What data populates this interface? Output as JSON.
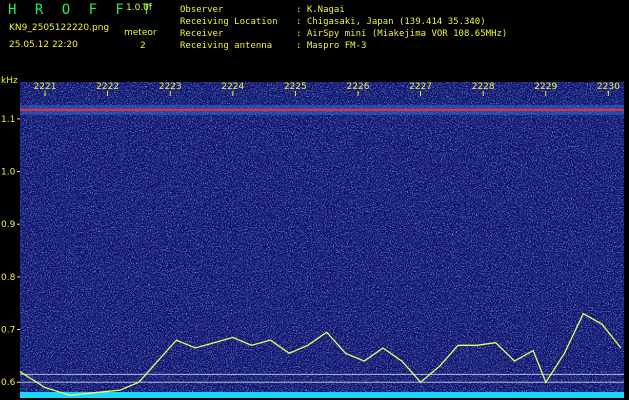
{
  "header": {
    "app_logo": "H R O F F T",
    "version": "1.0.0f",
    "filename": "KN9_2505122220.png",
    "timestamp": "25.05.12 22:20",
    "meteor_label": "meteor",
    "meteor_count": "2"
  },
  "station_info": [
    {
      "key": "Observer",
      "value": ": K.Nagai"
    },
    {
      "key": "Receiving Location",
      "value": ": Chigasaki, Japan (139.414 35.340)"
    },
    {
      "key": "Receiver",
      "value": ": AirSpy mini (Miakejima VOR 108.65MHz)"
    },
    {
      "key": "Receiving antenna",
      "value": ": Maspro FM-3"
    }
  ],
  "colors": {
    "background": "#000000",
    "text_yellow": "#f2f23a",
    "logo_green": "#2ee855",
    "spectrogram_bg": "#0c0a6a",
    "carrier_line": "#ff2a20",
    "baseline_cyan": "#18d8ff",
    "trace": "#e8ff60"
  },
  "chart_data": {
    "type": "heatmap",
    "title": "",
    "ylabel": "kHz",
    "xlabel": "",
    "x_ticks": [
      "2221",
      "2222",
      "2223",
      "2224",
      "2225",
      "2226",
      "2227",
      "2228",
      "2229",
      "2230"
    ],
    "y_ticks": [
      "1.1",
      "1.0",
      "0.9",
      "0.8",
      "0.7",
      "0.6"
    ],
    "ylim": [
      0.57,
      1.17
    ],
    "xlim": [
      "2220.6",
      "2230.25"
    ],
    "carrier_freq_khz": 1.117,
    "reference_lines_khz": [
      0.615,
      0.6
    ],
    "trace": {
      "x_min": [
        2220.6,
        2221.0,
        2221.4,
        2221.8,
        2222.2,
        2222.5,
        2222.8,
        2223.1,
        2223.4,
        2223.7,
        2224.0,
        2224.3,
        2224.6,
        2224.9,
        2225.2,
        2225.5,
        2225.8,
        2226.1,
        2226.4,
        2226.7,
        2227.0,
        2227.3,
        2227.6,
        2227.9,
        2228.2,
        2228.5,
        2228.8,
        2229.0,
        2229.3,
        2229.6,
        2229.9,
        2230.2
      ],
      "khz": [
        0.62,
        0.59,
        0.575,
        0.58,
        0.585,
        0.6,
        0.64,
        0.68,
        0.665,
        0.675,
        0.685,
        0.67,
        0.68,
        0.655,
        0.67,
        0.695,
        0.655,
        0.64,
        0.665,
        0.64,
        0.6,
        0.63,
        0.67,
        0.67,
        0.675,
        0.64,
        0.66,
        0.6,
        0.655,
        0.73,
        0.71,
        0.665
      ]
    }
  }
}
